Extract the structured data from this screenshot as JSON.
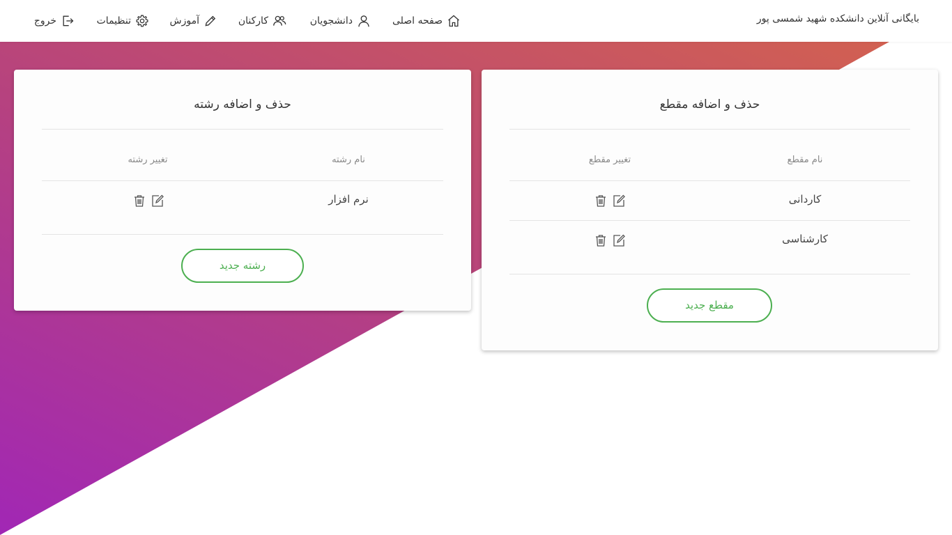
{
  "navbar": {
    "brand": "بایگانی آنلاین دانشکده شهید شمسی پور",
    "items": [
      {
        "label": "صفحه اصلی",
        "icon": "home-icon"
      },
      {
        "label": "دانشجویان",
        "icon": "user-icon"
      },
      {
        "label": "کارکنان",
        "icon": "users-icon"
      },
      {
        "label": "آموزش",
        "icon": "pencil-icon"
      },
      {
        "label": "تنظیمات",
        "icon": "gear-icon"
      },
      {
        "label": "خروج",
        "icon": "logout-icon"
      }
    ]
  },
  "degree_card": {
    "title": "حذف و اضافه مقطع",
    "col_name": "نام مقطع",
    "col_actions": "تغییر مقطع",
    "rows": [
      {
        "name": "کاردانی"
      },
      {
        "name": "کارشناسی"
      }
    ],
    "button": "مقطع جدید"
  },
  "major_card": {
    "title": "حذف و اضافه رشته",
    "col_name": "نام رشته",
    "col_actions": "تغییر رشته",
    "rows": [
      {
        "name": "نرم افزار"
      }
    ],
    "button": "رشته جدید"
  },
  "colors": {
    "accent": "#4caf50",
    "gradient_start": "#a127b5",
    "gradient_end": "#d6654a"
  }
}
